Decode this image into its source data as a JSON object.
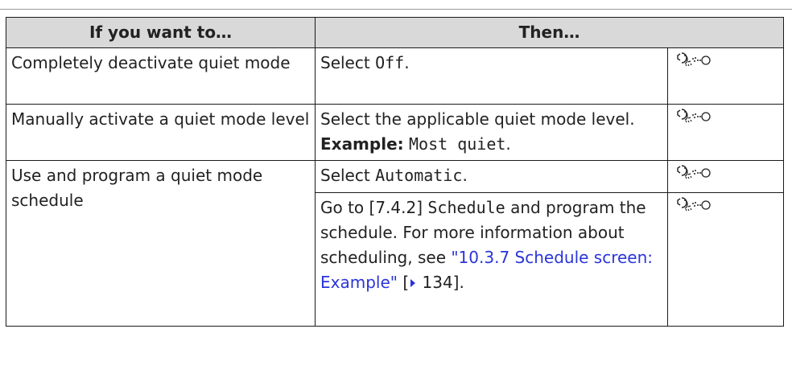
{
  "table": {
    "headers": {
      "col1": "If you want to…",
      "col2": "Then…"
    },
    "rows": [
      {
        "condition": "Completely deactivate quiet mode",
        "action_prefix": "Select ",
        "action_code": "Off",
        "action_suffix": ".",
        "icon": "user-interface-icon"
      },
      {
        "condition": "Manually activate a quiet mode level",
        "action_prefix": "Select the applicable quiet mode level. ",
        "action_bold": "Example:",
        "action_code": "Most quiet",
        "action_suffix": ".",
        "icon": "user-interface-icon"
      },
      {
        "condition": "Use and program a quiet mode schedule",
        "step1_prefix": "Select ",
        "step1_code": "Automatic",
        "step1_suffix": ".",
        "step2_prefix": "Go to [7.4.2] ",
        "step2_code": "Schedule",
        "step2_middle": " and program the schedule. For more information about scheduling, see ",
        "step2_link": "\"10.3.7 Schedule screen: Example\"",
        "step2_ref_open": " [",
        "step2_ref_page": " 134",
        "step2_ref_close": "].",
        "icon": "user-interface-icon"
      }
    ]
  },
  "colors": {
    "header_bg": "#d9d9d9",
    "link": "#2b34d9",
    "border": "#1a1a1a"
  }
}
